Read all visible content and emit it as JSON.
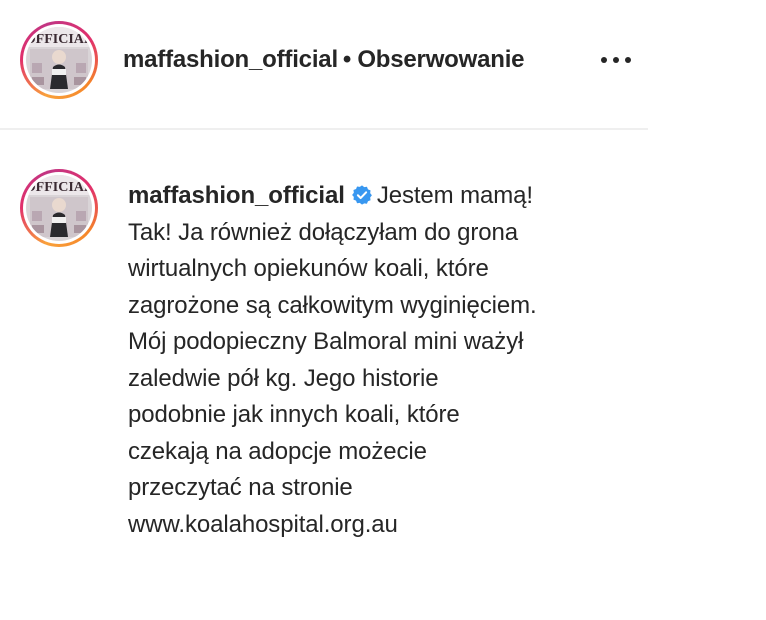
{
  "header": {
    "username": "maffashion_official",
    "separator": "•",
    "follow_label": "Obserwowanie",
    "more_icon": "more-horizontal-icon"
  },
  "caption": {
    "username": "maffashion_official",
    "verified_icon": "verified-badge-icon",
    "lines": [
      "Jestem mamą!",
      "Tak! Ja również dołączyłam do grona",
      "wirtualnych opiekunów koali, które",
      "zagrożone są całkowitym wyginięciem.",
      "Mój podopieczny Balmoral mini ważył",
      "zaledwie pół kg. Jego historie",
      "podobnie jak innych koali, które",
      "czekają na adopcje możecie",
      "przeczytać na stronie",
      "www.koalahospital.org.au"
    ]
  },
  "colors": {
    "text": "#262626",
    "divider": "#efefef",
    "verified": "#3897f0",
    "story_ring_start": "#f9a13b",
    "story_ring_end": "#c13584"
  }
}
